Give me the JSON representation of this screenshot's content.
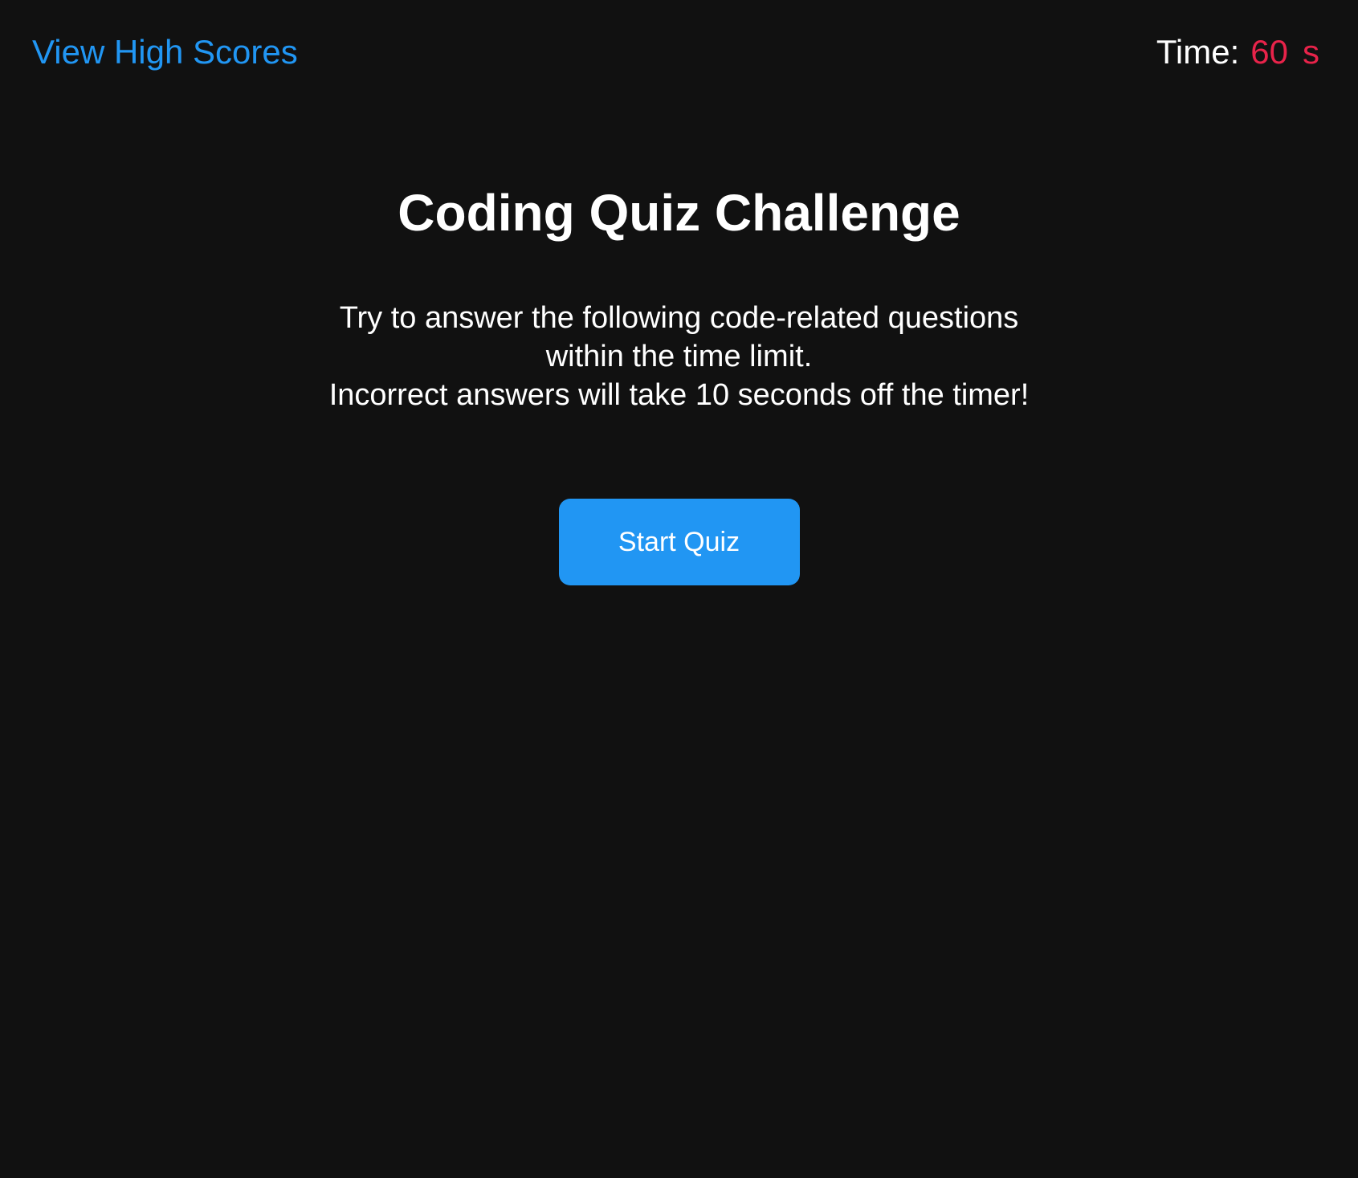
{
  "header": {
    "high_scores_link": "View High Scores",
    "timer_label": "Time:",
    "timer_value": "60",
    "timer_unit": "s"
  },
  "main": {
    "title": "Coding Quiz Challenge",
    "intro_lines": [
      "Try to answer the following code-related questions",
      "within the time limit.",
      "Incorrect answers will take 10 seconds off the timer!"
    ],
    "start_button_label": "Start Quiz"
  },
  "colors": {
    "background": "#111111",
    "accent": "#2196f3",
    "timer": "#e8234a",
    "text": "#ffffff"
  }
}
